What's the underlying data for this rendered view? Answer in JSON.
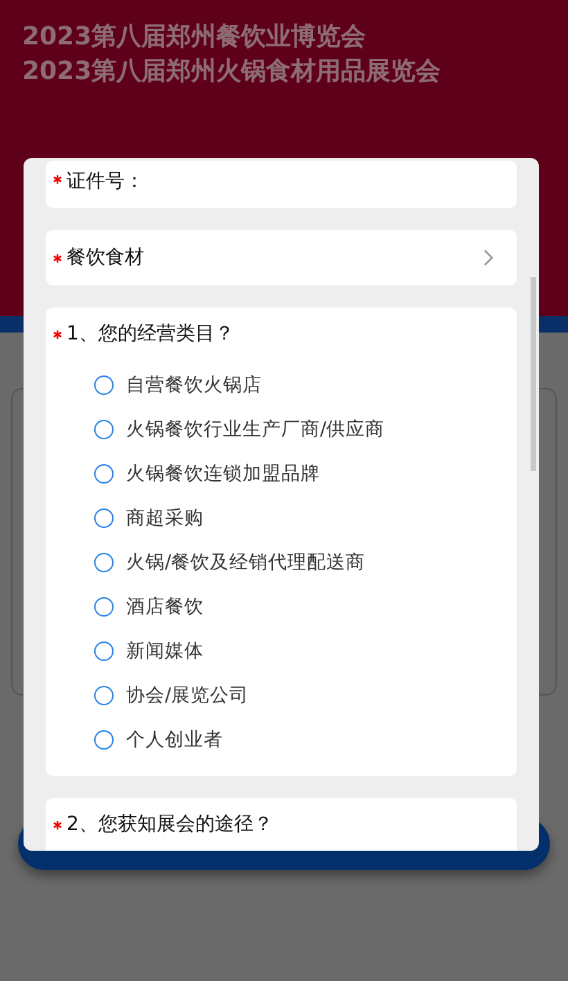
{
  "header": {
    "title_lines": [
      "2023第八届郑州餐饮业博览会",
      "2023第八届郑州火锅食材用品展览会"
    ]
  },
  "form": {
    "fields": [
      {
        "kind": "text",
        "label": "证件号：",
        "required": true
      },
      {
        "kind": "select",
        "label": "餐饮食材",
        "required": true
      }
    ],
    "questions": [
      {
        "title": "1、您的经营类目？",
        "required": true,
        "options": [
          {
            "label": "自营餐饮火锅店",
            "selected": false
          },
          {
            "label": "火锅餐饮行业生产厂商/供应商",
            "selected": false
          },
          {
            "label": "火锅餐饮连锁加盟品牌",
            "selected": false
          },
          {
            "label": "商超采购",
            "selected": false
          },
          {
            "label": "火锅/餐饮及经销代理配送商",
            "selected": false
          },
          {
            "label": "酒店餐饮",
            "selected": false
          },
          {
            "label": "新闻媒体",
            "selected": false
          },
          {
            "label": "协会/展览公司",
            "selected": false
          },
          {
            "label": "个人创业者",
            "selected": false
          }
        ]
      },
      {
        "title": "2、您获知展会的途径？",
        "required": true
      }
    ]
  }
}
